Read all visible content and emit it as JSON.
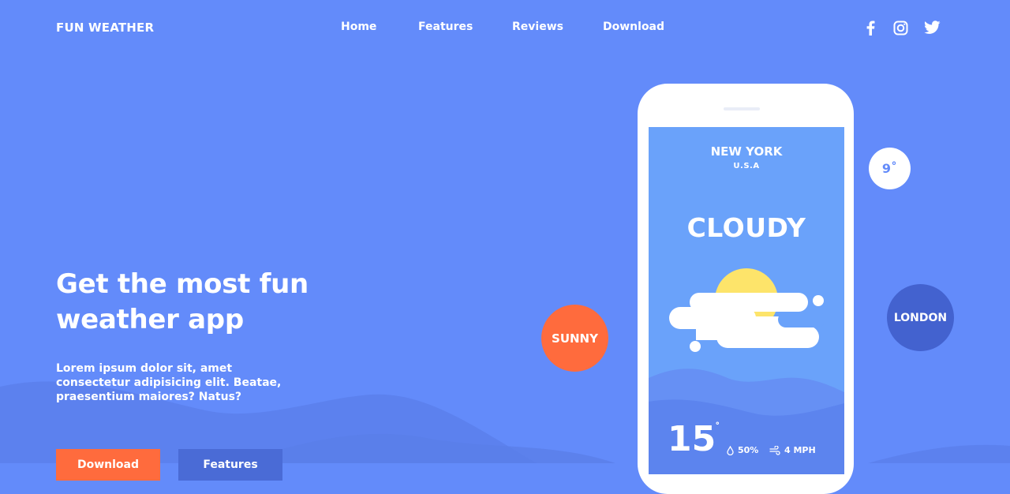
{
  "brand": "FUN WEATHER",
  "nav": {
    "items": [
      {
        "label": "Home"
      },
      {
        "label": "Features"
      },
      {
        "label": "Reviews"
      },
      {
        "label": "Download"
      }
    ]
  },
  "social": {
    "icons": [
      "facebook-icon",
      "instagram-icon",
      "twitter-icon"
    ]
  },
  "hero": {
    "title_line1": "Get the most fun",
    "title_line2": "weather app",
    "description": "Lorem ipsum dolor sit, amet consectetur adipisicing elit. Beatae, praesentium maiores? Natus?",
    "download_label": "Download",
    "features_label": "Features"
  },
  "badges": {
    "sunny": "SUNNY",
    "london": "LONDON",
    "temp": "9˚"
  },
  "phone": {
    "city": "NEW YORK",
    "country": "U.S.A",
    "condition": "CLOUDY",
    "temperature": "15",
    "degree": "˚",
    "humidity": "50%",
    "wind": "4 MPH"
  },
  "colors": {
    "background": "#638bfa",
    "accent_orange": "#ff6b3d",
    "accent_dark_blue": "#4362cf",
    "screen_blue": "#6aa2fa",
    "sun_yellow": "#fde46a"
  }
}
